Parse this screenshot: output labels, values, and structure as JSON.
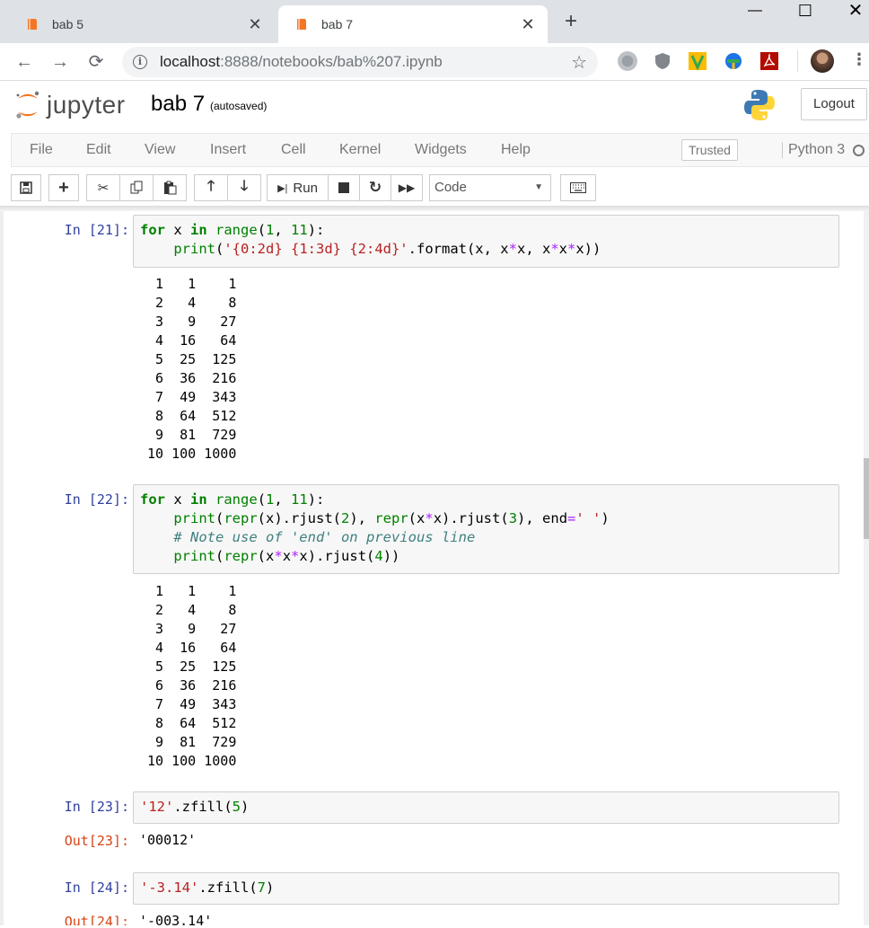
{
  "browser": {
    "tabs": [
      {
        "title": "bab 5",
        "active": false
      },
      {
        "title": "bab 7",
        "active": true
      }
    ],
    "new_tab": "+",
    "window_controls": {
      "minimize": "—",
      "maximize": "☐",
      "close": "✕"
    },
    "address": {
      "host": "localhost",
      "path": ":8888/notebooks/bab%207.ipynb"
    },
    "icons": [
      "back-icon",
      "forward-icon",
      "reload-icon",
      "info-icon",
      "star-icon",
      "globe-icon",
      "shield-icon",
      "v-extension-icon",
      "idm-icon",
      "pdf-icon",
      "avatar",
      "kebab-menu-icon"
    ]
  },
  "jupyter": {
    "logo_text": "jupyter",
    "notebook_name": "bab 7",
    "save_status": "(autosaved)",
    "logout_label": "Logout",
    "menu": [
      "File",
      "Edit",
      "View",
      "Insert",
      "Cell",
      "Kernel",
      "Widgets",
      "Help"
    ],
    "trusted_label": "Trusted",
    "kernel_name": "Python 3",
    "toolbar": {
      "run_label": "Run",
      "cell_type": "Code"
    }
  },
  "cells": [
    {
      "prompt": "In [21]:",
      "output": "  1   1    1\n  2   4    8\n  3   9   27\n  4  16   64\n  5  25  125\n  6  36  216\n  7  49  343\n  8  64  512\n  9  81  729\n 10 100 1000"
    },
    {
      "prompt": "In [22]:",
      "output": "  1   1    1\n  2   4    8\n  3   9   27\n  4  16   64\n  5  25  125\n  6  36  216\n  7  49  343\n  8  64  512\n  9  81  729\n 10 100 1000"
    },
    {
      "prompt": "In [23]:",
      "out_prompt": "Out[23]:",
      "output": "'00012'"
    },
    {
      "prompt": "In [24]:",
      "out_prompt": "Out[24]:",
      "output": "'-003.14'"
    }
  ]
}
